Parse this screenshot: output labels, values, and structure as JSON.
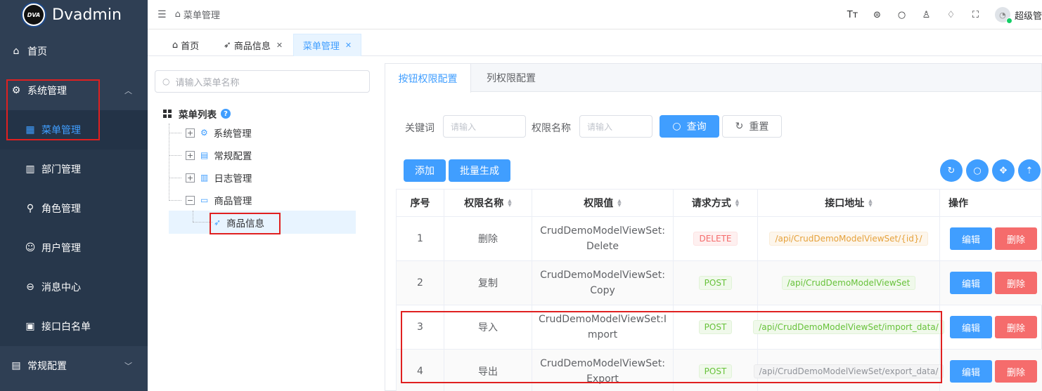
{
  "app": {
    "title": "Dvadmin",
    "logo_text": "DVA"
  },
  "sidebar": {
    "items": [
      {
        "label": "首页",
        "icon": "home-icon"
      },
      {
        "label": "系统管理",
        "icon": "gear-icon"
      },
      {
        "label": "菜单管理",
        "icon": "grid-icon"
      },
      {
        "label": "部门管理",
        "icon": "building-icon"
      },
      {
        "label": "角色管理",
        "icon": "role-icon"
      },
      {
        "label": "用户管理",
        "icon": "user-icon"
      },
      {
        "label": "消息中心",
        "icon": "message-icon"
      },
      {
        "label": "接口白名单",
        "icon": "whitelist-icon"
      },
      {
        "label": "常规配置",
        "icon": "config-icon"
      }
    ]
  },
  "header": {
    "breadcrumb": "菜单管理",
    "user_name": "超级管"
  },
  "tabs": [
    {
      "label": "首页"
    },
    {
      "label": "商品信息"
    },
    {
      "label": "菜单管理"
    }
  ],
  "tree": {
    "search_placeholder": "请输入菜单名称",
    "root_label": "菜单列表",
    "nodes": [
      {
        "label": "系统管理",
        "expander": "+"
      },
      {
        "label": "常规配置",
        "expander": "+"
      },
      {
        "label": "日志管理",
        "expander": "+"
      },
      {
        "label": "商品管理",
        "expander": "−"
      },
      {
        "label": "商品信息"
      }
    ]
  },
  "panel": {
    "tabs": [
      "按钮权限配置",
      "列权限配置"
    ],
    "keyword_label": "关键词",
    "keyword_placeholder": "请输入",
    "perm_name_label": "权限名称",
    "perm_name_placeholder": "请输入",
    "query_button": "查询",
    "reset_button": "重置",
    "add_button": "添加",
    "batch_button": "批量生成"
  },
  "table": {
    "headers": [
      "序号",
      "权限名称",
      "权限值",
      "请求方式",
      "接口地址",
      "操作"
    ],
    "rows": [
      {
        "index": "1",
        "name": "删除",
        "value": "CrudDemoModelViewSet:Delete",
        "method": "DELETE",
        "api": "/api/CrudDemoModelViewSet/{id}/"
      },
      {
        "index": "2",
        "name": "复制",
        "value": "CrudDemoModelViewSet:Copy",
        "method": "POST",
        "api": "/api/CrudDemoModelViewSet"
      },
      {
        "index": "3",
        "name": "导入",
        "value": "CrudDemoModelViewSet:Import",
        "method": "POST",
        "api": "/api/CrudDemoModelViewSet/import_data/"
      },
      {
        "index": "4",
        "name": "导出",
        "value": "CrudDemoModelViewSet:Export",
        "method": "POST",
        "api": "/api/CrudDemoModelViewSet/export_data/"
      }
    ],
    "edit_label": "编辑",
    "delete_label": "删除"
  },
  "colors": {
    "sidebar_bg": "#2f3f54",
    "primary": "#409eff",
    "danger": "#f56c6c",
    "highlight_box": "#e02020"
  }
}
